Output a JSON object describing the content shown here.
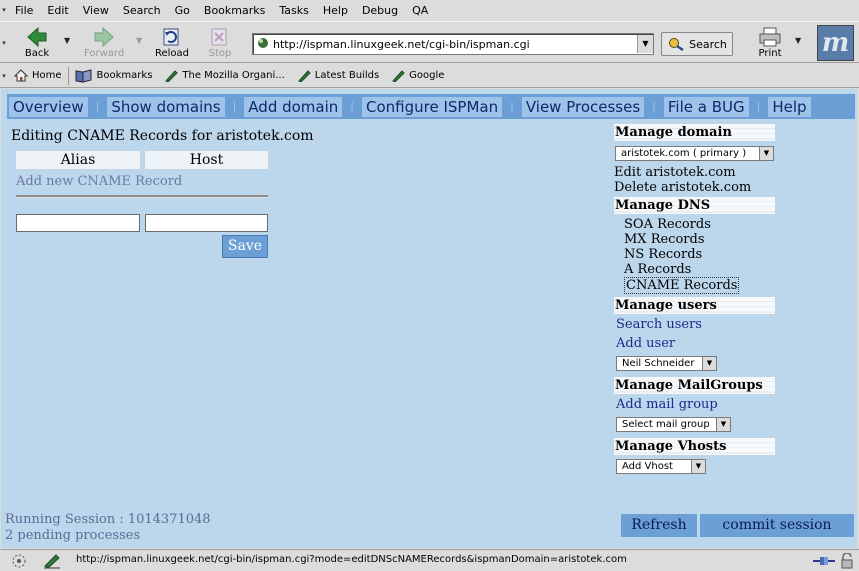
{
  "menu": [
    "File",
    "Edit",
    "View",
    "Search",
    "Go",
    "Bookmarks",
    "Tasks",
    "Help",
    "Debug",
    "QA"
  ],
  "toolbar": {
    "back_label": "Back",
    "forward_label": "Forward",
    "reload_label": "Reload",
    "stop_label": "Stop",
    "url": "http://ispman.linuxgeek.net/cgi-bin/ispman.cgi",
    "search_label": "Search",
    "print_label": "Print"
  },
  "personal_toolbar": [
    "Home",
    "Bookmarks",
    "The Mozilla Organi...",
    "Latest Builds",
    "Google"
  ],
  "nav_tabs": [
    "Overview",
    "Show domains",
    "Add domain",
    "Configure ISPMan",
    "View Processes",
    "File a BUG",
    "Help"
  ],
  "main": {
    "title": "Editing CNAME Records for aristotek.com",
    "col_alias": "Alias",
    "col_host": "Host",
    "add_new_label": "Add new CNAME Record",
    "alias_value": "",
    "host_value": "",
    "save_label": "Save"
  },
  "panel": {
    "manage_domain": "Manage domain",
    "domain_select": "aristotek.com ( primary )",
    "edit_domain": "Edit aristotek.com",
    "delete_domain": "Delete aristotek.com",
    "manage_dns": "Manage DNS",
    "dns_links": [
      "SOA Records",
      "MX Records",
      "NS Records",
      "A Records",
      "CNAME Records"
    ],
    "manage_users": "Manage users",
    "search_users": "Search users",
    "add_user": "Add user",
    "user_select": "Neil Schneider",
    "manage_mail_groups": "Manage MailGroups",
    "add_mail_group": "Add mail group",
    "mail_group_select": "Select mail group",
    "manage_vhosts": "Manage Vhosts",
    "vhost_select": "Add Vhost"
  },
  "session": {
    "running": "Running Session : 1014371048",
    "pending": "2 pending processes"
  },
  "bottom": {
    "refresh_label": "Refresh",
    "commit_label": "commit session"
  },
  "status_bar": {
    "url": "http://ispman.linuxgeek.net/cgi-bin/ispman.cgi?mode=editDNScNAMERecords&ispmanDomain=aristotek.com"
  },
  "colors": {
    "content_bg": "#bcd6ec",
    "nav_bar": "#6c9fd6",
    "link_blue": "#1a2a8c"
  }
}
